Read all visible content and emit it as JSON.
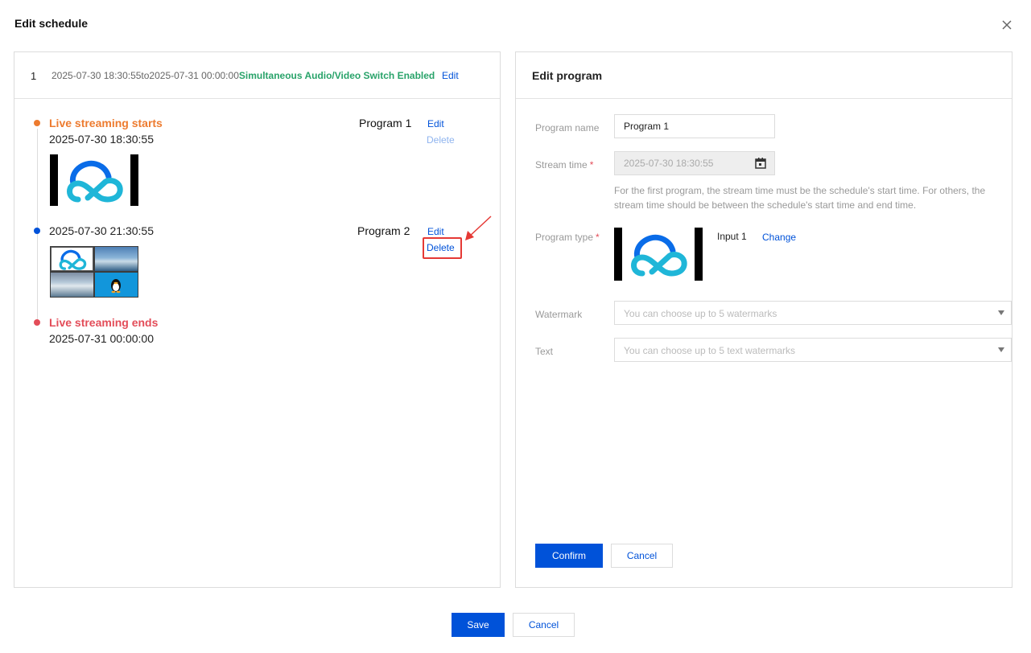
{
  "dialog": {
    "title": "Edit schedule",
    "close_icon": "close-icon"
  },
  "schedule": {
    "index": "1",
    "range": "2025-07-30 18:30:55to2025-07-31 00:00:00",
    "switch_status": "Simultaneous Audio/Video Switch Enabled",
    "edit_label": "Edit"
  },
  "timeline": {
    "start": {
      "title": "Live streaming starts",
      "time": "2025-07-30 18:30:55"
    },
    "second": {
      "time": "2025-07-30 21:30:55"
    },
    "end": {
      "title": "Live streaming ends",
      "time": "2025-07-31 00:00:00"
    }
  },
  "programs": [
    {
      "name": "Program 1",
      "edit_label": "Edit",
      "delete_label": "Delete",
      "delete_disabled": true
    },
    {
      "name": "Program 2",
      "edit_label": "Edit",
      "delete_label": "Delete",
      "delete_disabled": false
    }
  ],
  "edit_program": {
    "title": "Edit program",
    "name_label": "Program name",
    "name_value": "Program 1",
    "stream_time_label": "Stream time",
    "stream_time_value": "2025-07-30 18:30:55",
    "required_mark": "*",
    "hint": "For the first program, the stream time must be the schedule's start time. For others, the stream time should be between the schedule's start time and end time.",
    "type_label": "Program type",
    "input_label": "Input 1",
    "change_label": "Change",
    "watermark_label": "Watermark",
    "watermark_placeholder": "You can choose up to 5 watermarks",
    "text_label": "Text",
    "text_placeholder": "You can choose up to 5 text watermarks",
    "confirm_label": "Confirm",
    "cancel_label": "Cancel"
  },
  "footer": {
    "save_label": "Save",
    "cancel_label": "Cancel"
  },
  "colors": {
    "primary": "#0052d9",
    "start": "#ed7b2f",
    "end": "#e34d59",
    "enabled": "#29a36a",
    "highlight": "#e53935"
  }
}
